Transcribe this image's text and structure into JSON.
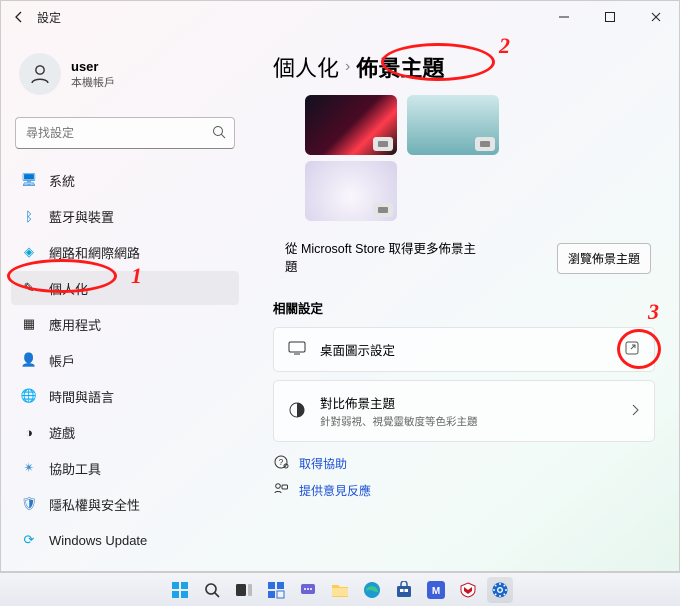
{
  "window": {
    "title": "設定"
  },
  "account": {
    "name": "user",
    "subtitle": "本機帳戶"
  },
  "search": {
    "placeholder": "尋找設定"
  },
  "nav": {
    "items": [
      {
        "label": "系統",
        "icon": "🖥",
        "color": "#0078d4"
      },
      {
        "label": "藍牙與裝置",
        "icon": "ᛒ",
        "color": "#0078d4"
      },
      {
        "label": "網路和網際網路",
        "icon": "◈",
        "color": "#0aa5d9"
      },
      {
        "label": "個人化",
        "icon": "✎",
        "color": "#3a3a3a"
      },
      {
        "label": "應用程式",
        "icon": "▦",
        "color": "#3a3a3a"
      },
      {
        "label": "帳戶",
        "icon": "👤",
        "color": "#1aa06e"
      },
      {
        "label": "時間與語言",
        "icon": "🌐",
        "color": "#1e6fd9"
      },
      {
        "label": "遊戲",
        "icon": "◑",
        "color": "#444"
      },
      {
        "label": "協助工具",
        "icon": "✴",
        "color": "#3b8fd1"
      },
      {
        "label": "隱私權與安全性",
        "icon": "🛡",
        "color": "#2c78c5"
      },
      {
        "label": "Windows Update",
        "icon": "⟳",
        "color": "#0aa3dd"
      }
    ],
    "active_index": 3
  },
  "breadcrumb": {
    "root": "個人化",
    "sep": "›",
    "leaf": "佈景主題"
  },
  "themes": {
    "more_text": "從 Microsoft Store 取得更多佈景主題",
    "browse_label": "瀏覽佈景主題"
  },
  "related": {
    "heading": "相關設定",
    "desktop_icons": {
      "title": "桌面圖示設定"
    },
    "contrast": {
      "title": "對比佈景主題",
      "subtitle": "針對弱視、視覺靈敏度等色彩主題"
    }
  },
  "links": {
    "help": "取得協助",
    "feedback": "提供意見反應"
  },
  "annotations": {
    "n1": "1",
    "n2": "2",
    "n3": "3"
  }
}
